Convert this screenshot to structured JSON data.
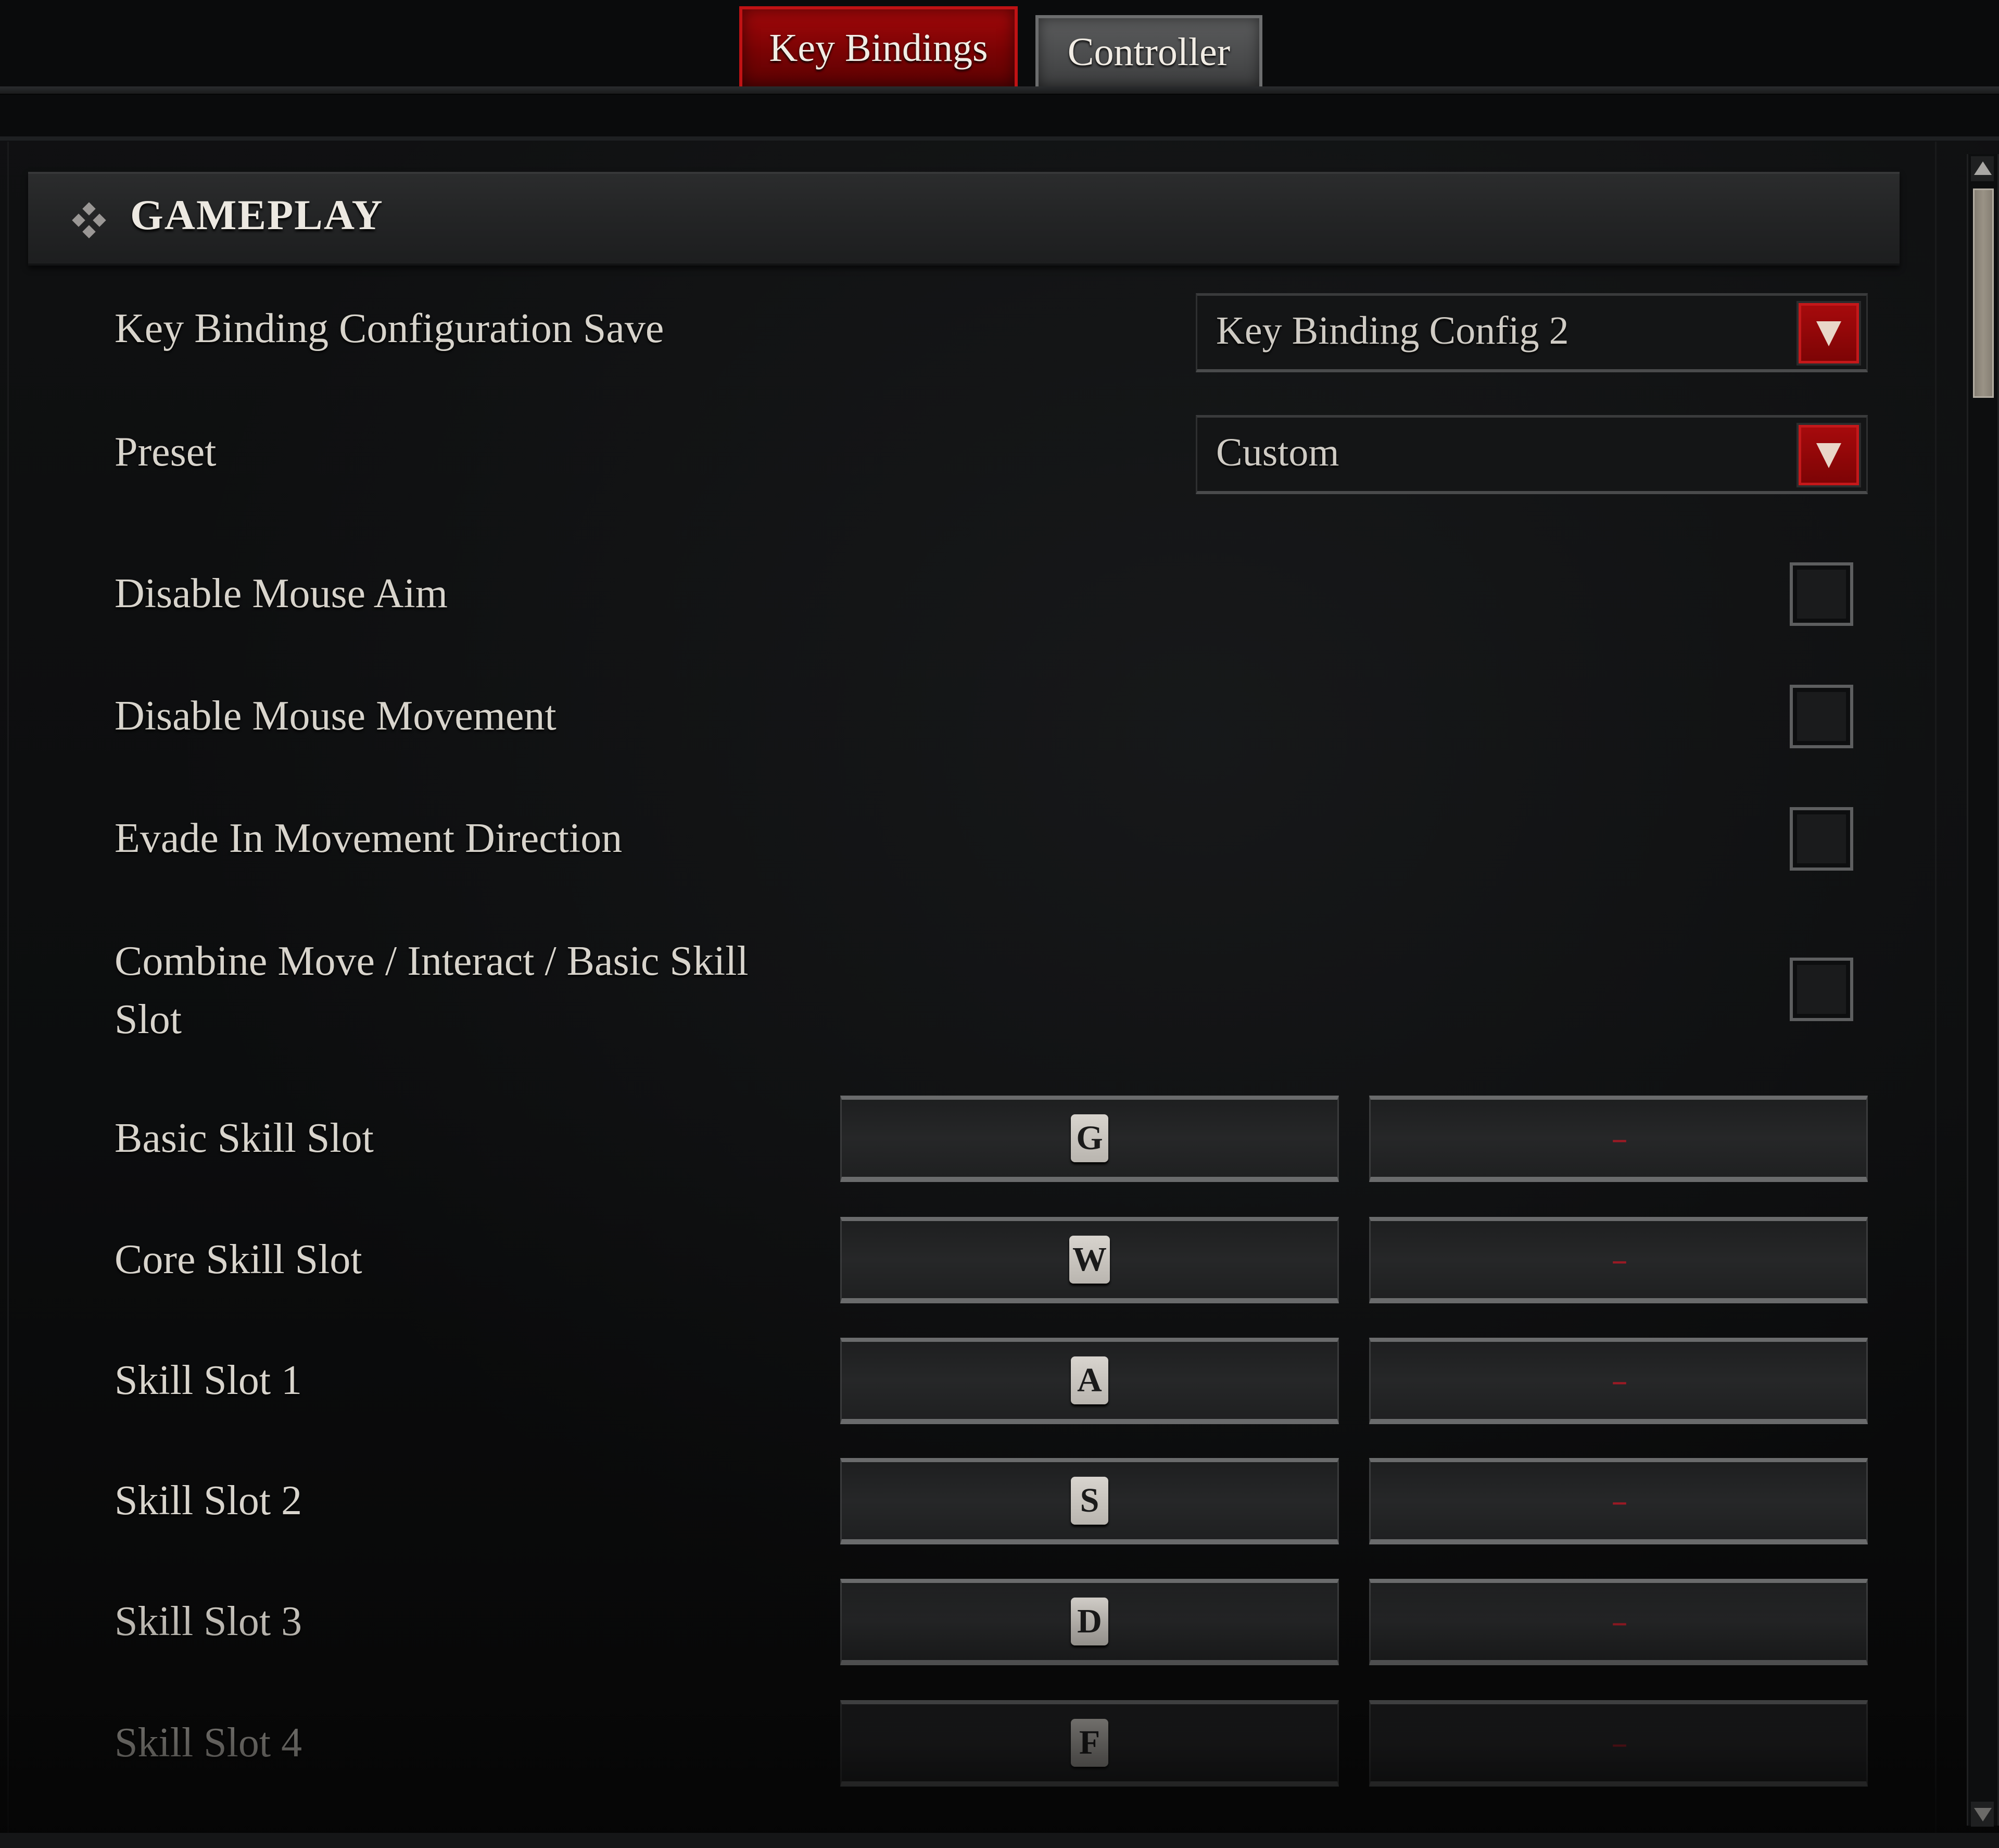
{
  "tabs": [
    {
      "label": "Key Bindings",
      "active": true
    },
    {
      "label": "Controller",
      "active": false
    }
  ],
  "section": {
    "title": "GAMEPLAY",
    "icon": "diamond-cluster-icon"
  },
  "dropdowns": [
    {
      "label": "Key Binding Configuration Save",
      "value": "Key Binding Config 2"
    },
    {
      "label": "Preset",
      "value": "Custom"
    }
  ],
  "checkboxes": [
    {
      "label": "Disable Mouse Aim",
      "checked": false
    },
    {
      "label": "Disable Mouse Movement",
      "checked": false
    },
    {
      "label": "Evade In Movement Direction",
      "checked": false
    },
    {
      "label": "Combine Move / Interact / Basic Skill Slot",
      "label_line1": "Combine Move / Interact / Basic Skill",
      "label_line2": "Slot",
      "checked": false
    }
  ],
  "bindings": [
    {
      "label": "Basic Skill Slot",
      "primary": "G",
      "secondary": "--"
    },
    {
      "label": "Core Skill Slot",
      "primary": "W",
      "secondary": "--"
    },
    {
      "label": "Skill Slot 1",
      "primary": "A",
      "secondary": "--"
    },
    {
      "label": "Skill Slot 2",
      "primary": "S",
      "secondary": "--"
    },
    {
      "label": "Skill Slot 3",
      "primary": "D",
      "secondary": "--"
    },
    {
      "label": "Skill Slot 4",
      "primary": "F",
      "secondary": "--"
    }
  ],
  "colors": {
    "accent_red": "#a3080a",
    "unbound_red": "#9b1a24",
    "text": "#d8d4cc",
    "background": "#0b0c0d"
  }
}
